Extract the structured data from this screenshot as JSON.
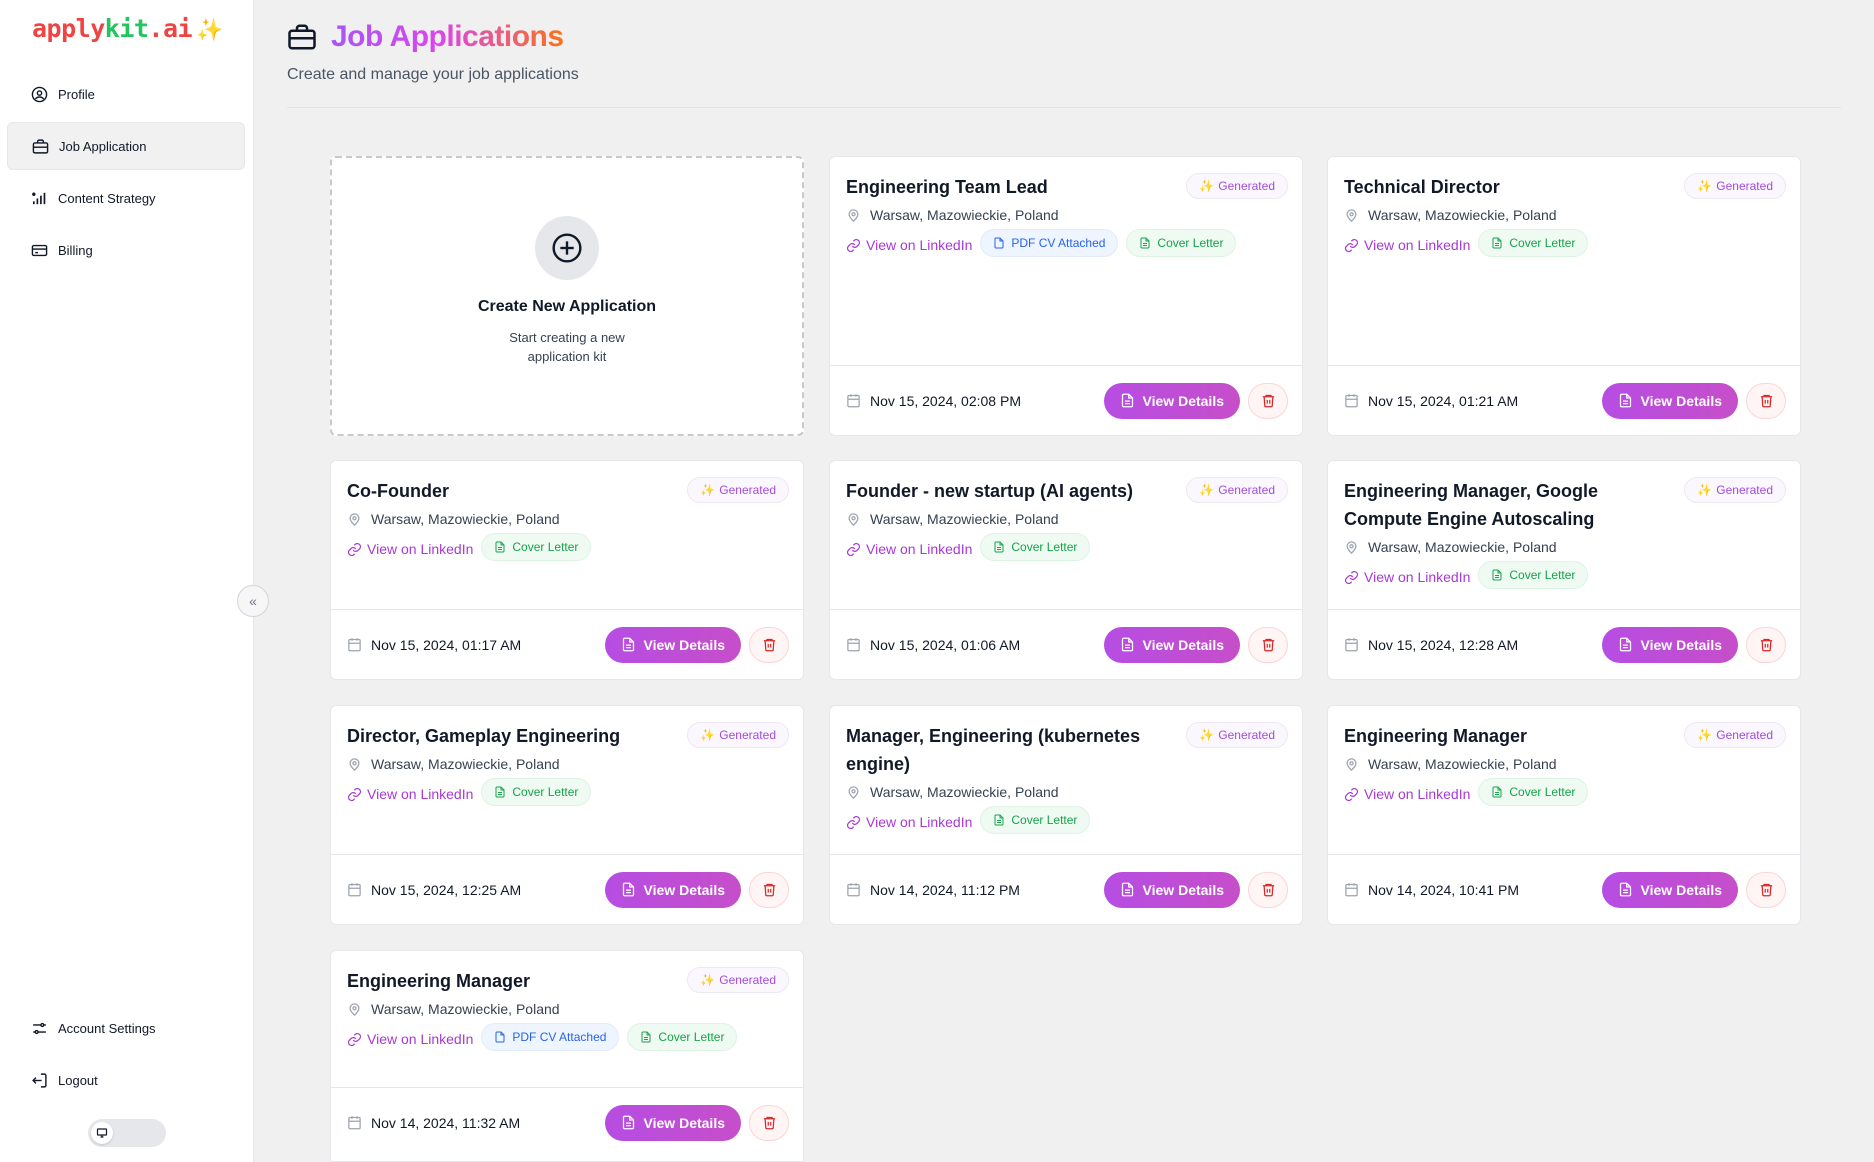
{
  "app": {
    "logo_a": "apply",
    "logo_b": "kit",
    "logo_c": ".ai",
    "logo_spark": "✨"
  },
  "sidebar": {
    "items": [
      {
        "label": "Profile",
        "icon": "user-circle-icon"
      },
      {
        "label": "Job Application",
        "icon": "briefcase-icon",
        "active": true
      },
      {
        "label": "Content Strategy",
        "icon": "bar-chart-icon"
      },
      {
        "label": "Billing",
        "icon": "credit-card-icon"
      }
    ],
    "bottom": [
      {
        "label": "Account Settings",
        "icon": "sliders-icon"
      },
      {
        "label": "Logout",
        "icon": "logout-icon"
      }
    ],
    "collapse_glyph": "«"
  },
  "header": {
    "title": "Job Applications",
    "subtitle": "Create and manage your job applications"
  },
  "create": {
    "title": "Create New Application",
    "subtitle": "Start creating a new application kit"
  },
  "labels": {
    "generated": "Generated",
    "linkedin": "View on LinkedIn",
    "pdf": "PDF CV Attached",
    "cover": "Cover Letter",
    "view": "View Details",
    "location": "Warsaw, Mazowieckie, Poland"
  },
  "applications": [
    {
      "title": "Engineering Team Lead",
      "date": "Nov 15, 2024, 02:08 PM",
      "pdf": true
    },
    {
      "title": "Technical Director",
      "date": "Nov 15, 2024, 01:21 AM",
      "pdf": false
    },
    {
      "title": "Co-Founder",
      "date": "Nov 15, 2024, 01:17 AM",
      "pdf": false
    },
    {
      "title": "Founder - new startup (AI agents)",
      "date": "Nov 15, 2024, 01:06 AM",
      "pdf": false
    },
    {
      "title": "Engineering Manager, Google Compute Engine Autoscaling",
      "date": "Nov 15, 2024, 12:28 AM",
      "pdf": false
    },
    {
      "title": "Director, Gameplay Engineering",
      "date": "Nov 15, 2024, 12:25 AM",
      "pdf": false
    },
    {
      "title": "Manager, Engineering (kubernetes engine)",
      "date": "Nov 14, 2024, 11:12 PM",
      "pdf": false
    },
    {
      "title": "Engineering Manager",
      "date": "Nov 14, 2024, 10:41 PM",
      "pdf": false
    },
    {
      "title": "Engineering Manager",
      "date": "Nov 14, 2024, 11:32 AM",
      "pdf": true
    }
  ]
}
